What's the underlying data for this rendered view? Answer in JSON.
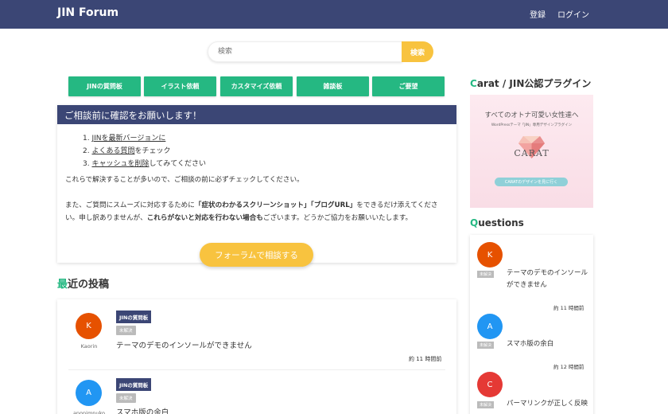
{
  "header": {
    "brand": "JIN Forum",
    "register": "登録",
    "login": "ログイン",
    "bg_color": "#3b4675"
  },
  "search": {
    "placeholder": "検索",
    "button": "検索"
  },
  "categories": [
    "JINの質問板",
    "イラスト依頼",
    "カスタマイズ依頼",
    "雑談板",
    "ご要望"
  ],
  "notice": {
    "title": "ご相談前に確認をお願いします！",
    "steps": [
      {
        "num": "1.",
        "link": "JINを最新バージョンに",
        "rest": ""
      },
      {
        "num": "2.",
        "link": "よくある質問",
        "rest": "をチェック"
      },
      {
        "num": "3.",
        "link": "キャッシュを削除",
        "rest": "してみてください"
      }
    ],
    "para1": "これらで解決することが多いので、ご相談の前に必ずチェックしてください。",
    "para2_a": "また、ご質問にスムーズに対応するために",
    "para2_b": "「症状のわかるスクリーンショット」「ブログURL」",
    "para2_c": "をできるだけ添えてください。申し訳ありませんが、",
    "para2_d": "これらがないと対応を行わない場合も",
    "para2_e": "ございます。どうかご協力をお願いいたします。"
  },
  "consult_button": "フォーラムで相談する",
  "recent": {
    "title_accent": "最",
    "title_rest": "近の投稿",
    "posts": [
      {
        "initial": "K",
        "author": "Kaorin",
        "category": "JINの質問板",
        "status": "未解決",
        "title": "テーマのデモのインソールができません",
        "time": "約 11 時間前",
        "color": "#e65100"
      },
      {
        "initial": "A",
        "author": "anonimnuko",
        "category": "JINの質問板",
        "status": "未解決",
        "title": "スマホ版の余白",
        "time": "",
        "color": "#2196f3"
      }
    ]
  },
  "sidebar": {
    "plugin_title_accent": "C",
    "plugin_title_rest": "arat / JIN公認プラグイン",
    "ad": {
      "line1": "すべてのオトナ可愛い女性達へ",
      "line2": "WordPressテーマ「JIN」専用デザインプラグイン",
      "logo": "CARAT",
      "button": "CARATのデザインを見に行く"
    },
    "questions_title_accent": "Q",
    "questions_title_rest": "uestions",
    "questions": [
      {
        "initial": "K",
        "status": "未解決",
        "title": "テーマのデモのインソールができません",
        "time": "約 11 時間前",
        "color": "#e65100"
      },
      {
        "initial": "A",
        "status": "未解決",
        "title": "スマホ版の余白",
        "time": "約 12 時間前",
        "color": "#2196f3"
      },
      {
        "initial": "C",
        "status": "未解決",
        "title": "パーマリンクが正しく反映",
        "time": "",
        "color": "#e53935"
      }
    ]
  },
  "accent_color": "#25b882",
  "button_color": "#f8c33f"
}
